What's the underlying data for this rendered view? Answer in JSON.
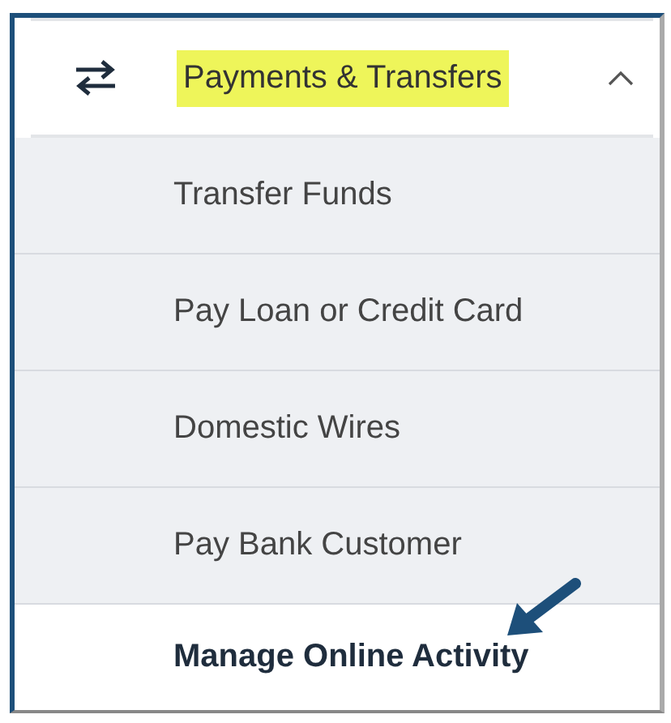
{
  "menu": {
    "label": "Payments & Transfers",
    "highlighted": true,
    "expanded": true,
    "items": [
      {
        "label": "Transfer Funds",
        "selected": false
      },
      {
        "label": "Pay Loan or Credit Card",
        "selected": false
      },
      {
        "label": "Domestic Wires",
        "selected": false
      },
      {
        "label": "Pay Bank Customer",
        "selected": false
      },
      {
        "label": "Manage Online Activity",
        "selected": true
      }
    ]
  }
}
